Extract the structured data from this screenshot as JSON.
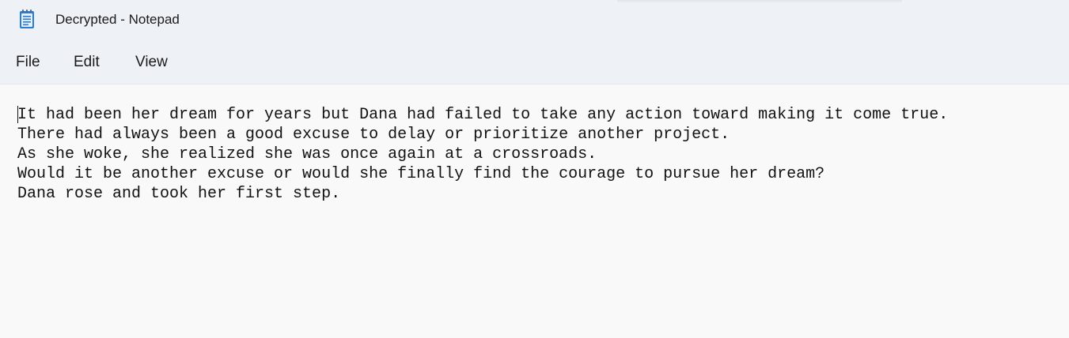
{
  "window": {
    "title": "Decrypted - Notepad",
    "icon": "notepad-icon"
  },
  "menu": {
    "file_label": "File",
    "edit_label": "Edit",
    "view_label": "View"
  },
  "document": {
    "lines": [
      "It had been her dream for years but Dana had failed to take any action toward making it come true.",
      "There had always been a good excuse to delay or prioritize another project.",
      "As she woke, she realized she was once again at a crossroads.",
      "Would it be another excuse or would she finally find the courage to pursue her dream?",
      "Dana rose and took her first step."
    ]
  },
  "colors": {
    "chrome_background": "#eef2f6",
    "editor_background": "#f9f9f9",
    "text": "#111111",
    "icon_accent": "#2b7cd3"
  }
}
